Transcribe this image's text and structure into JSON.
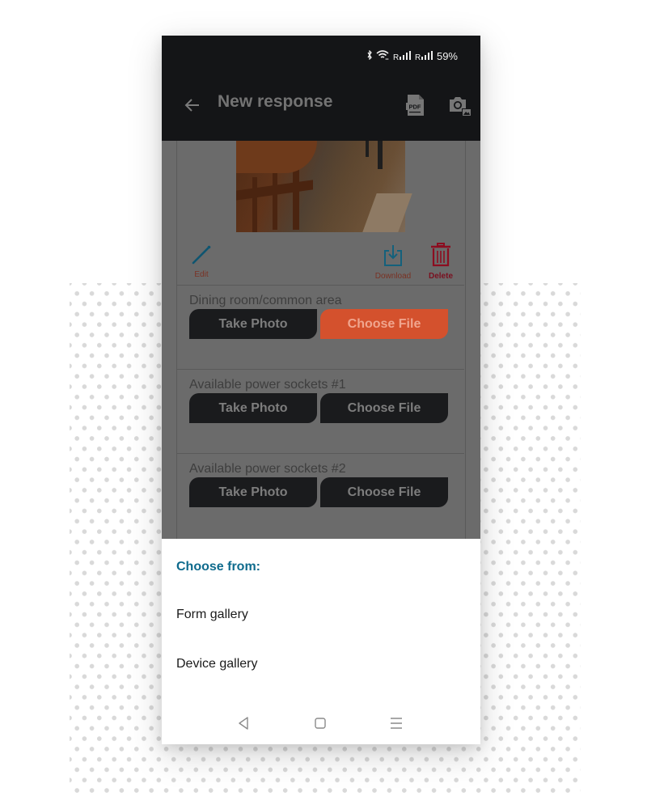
{
  "status_bar": {
    "bluetooth_icon": "bluetooth-icon",
    "wifi_icon": "wifi-icon",
    "signal_1": "R",
    "signal_2": "R",
    "battery": "59%"
  },
  "app_bar": {
    "title": "New response",
    "back_icon": "arrow-left-icon",
    "actions": [
      "pdf-icon",
      "camera-gallery-icon"
    ]
  },
  "photo_actions": {
    "edit_label": "Edit",
    "download_label": "Download",
    "delete_label": "Delete",
    "colors": {
      "edit": "#0f6b8d",
      "download": "#1d87a8",
      "delete": "#c8102e",
      "label": "#b23a28"
    }
  },
  "sections": [
    {
      "label": "Dining room/common area",
      "take_photo": "Take Photo",
      "choose_file": "Choose File",
      "active": true
    },
    {
      "label": "Available power sockets #1",
      "take_photo": "Take Photo",
      "choose_file": "Choose File",
      "active": false
    },
    {
      "label": "Available power sockets #2",
      "take_photo": "Take Photo",
      "choose_file": "Choose File",
      "active": false
    }
  ],
  "bottom_sheet": {
    "title": "Choose from:",
    "items": [
      "Form gallery",
      "Device gallery"
    ]
  },
  "nav_bar": {
    "buttons": [
      "back-triangle-icon",
      "home-square-icon",
      "recents-menu-icon"
    ]
  },
  "colors": {
    "accent": "#d4512d",
    "sheet_title": "#0f6b8d",
    "app_bar": "#141517"
  }
}
